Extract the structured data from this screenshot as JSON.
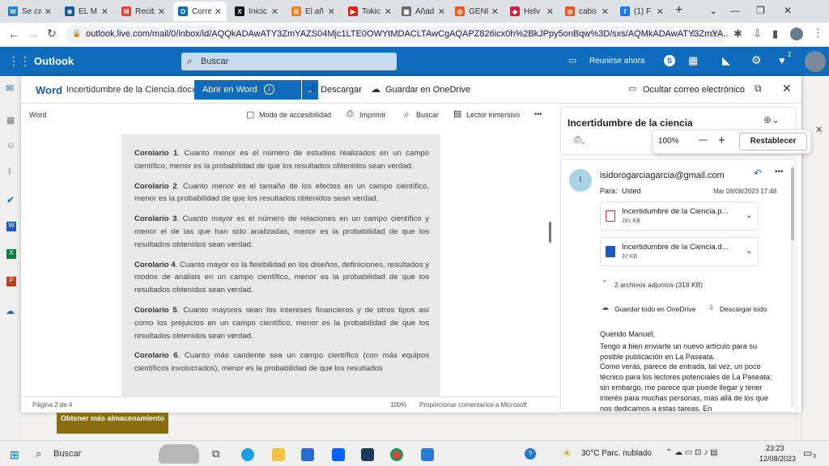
{
  "browser": {
    "tabs": [
      {
        "label": "Se ca",
        "color": "#1f7ad4",
        "glyph": "W"
      },
      {
        "label": "EL M",
        "color": "#0f5aa8",
        "glyph": "⊕"
      },
      {
        "label": "Recib",
        "color": "#ea4335",
        "glyph": "M"
      },
      {
        "label": "Corre",
        "color": "#0f6cbd",
        "glyph": "O"
      },
      {
        "label": "Inicic",
        "color": "#111111",
        "glyph": "X"
      },
      {
        "label": "El añ",
        "color": "#f4811f",
        "glyph": "B"
      },
      {
        "label": "Tokic",
        "color": "#e62117",
        "glyph": "▶"
      },
      {
        "label": "Añadi",
        "color": "#666666",
        "glyph": "▣"
      },
      {
        "label": "GENI",
        "color": "#e8561a",
        "glyph": "◎"
      },
      {
        "label": "Helv",
        "color": "#d21f3c",
        "glyph": "◆"
      },
      {
        "label": "cabo",
        "color": "#e8561a",
        "glyph": "◎"
      },
      {
        "label": "(1) F",
        "color": "#1877f2",
        "glyph": "f"
      }
    ],
    "new_tab": "+",
    "url": "outlook.live.com/mail/0/inbox/id/AQQkADAwATY3ZmYAZS04Mjc1LTE0OWYtMDACLTAwCgAQAPZ826icx0h%2BkJPpy5onBqw%3D/sxs/AQMkADAwATY3ZmYA..."
  },
  "outlook": {
    "app_name": "Outlook",
    "search_placeholder": "Buscar",
    "meeting_label": "Reunirse ahora",
    "notification_count": "2"
  },
  "viewer": {
    "app_label": "Word",
    "filename": "Incertidumbre de la Ciencia.docx",
    "open_in_word": "Abrir en Word",
    "download": "Descargar",
    "save_onedrive": "Guardar en OneDrive",
    "hide_email": "Ocultar correo electrónico",
    "word_label": "Word",
    "accessibility": "Modo de accesibilidad",
    "print": "Imprimir",
    "search": "Buscar",
    "reader": "Lector inmersivo",
    "more": "•••",
    "page_info": "Página 2 de 4",
    "zoom": "100%",
    "feedback": "Proporcionar comentarios a Microsoft"
  },
  "document": {
    "paragraphs": [
      {
        "label": "Corolario 1",
        "text": ". Cuanto menor es el número de estudios realizados en un campo científico, menor es la probabilidad de que los resultados obtenidos sean verdad."
      },
      {
        "label": "Corolario 2",
        "text": ". Cuanto menor es el tamaño de los efectos en un campo científico, menor es la probabilidad de que los resultados obtenidos sean verdad."
      },
      {
        "label": "Corolario 3",
        "text": ". Cuanto mayor es el número de relaciones en un campo científico y menor el de las que han sido analizadas, menor es la probabilidad de que los resultados obtenidos sean verdad."
      },
      {
        "label": "Corolario 4",
        "text": ". Cuanto mayor es la flexibilidad en los diseños, definiciones, resultados y modos de análisis en un campo científico, menor es la probabilidad de que los resultados obtenidos sean verdad."
      },
      {
        "label": "Corolario 5",
        "text": ". Cuanto mayores sean los intereses financieros y de otros tipos así como los prejuicios en un campo científico, menor es la probabilidad de que los resultados obtenidos sean verdad."
      },
      {
        "label": "Corolario 6",
        "text": ". Cuanto más candente sea un campo científico (con más equipos científicos involucrados), menor es la probabilidad de que los resultados"
      }
    ]
  },
  "pane": {
    "subject": "Incertidumbre de la ciencia",
    "zoom_value": "100%",
    "zoom_minus": "—",
    "zoom_plus": "+",
    "reset": "Restablecer",
    "sender_initial": "I",
    "sender": "isidorogarciagarcia@gmail.com",
    "to_label": "Para:",
    "to_value": "Usted",
    "date": "Mar 08/08/2023 17:48",
    "attachments": [
      {
        "name": "Incertidumbre de la Ciencia.p...",
        "size": "281 KB",
        "kind": "pdf",
        "color": "#d13438"
      },
      {
        "name": "Incertidumbre de la Ciencia.d...",
        "size": "37 KB",
        "kind": "docx",
        "color": "#185abd"
      }
    ],
    "attachments_count": "2 archivos adjuntos (318 KB)",
    "save_all": "Guardar todo en OneDrive",
    "download_all": "Descargar todo",
    "body": [
      "Querido Manuel,",
      "Tengo a bien enviarte un nuevo artículo para su posible publicación en La Paseata.",
      "Como verás, parece de entrada, tal vez, un poco técnico para los lectores potenciales de La Paseata; sin embargo, me parece que puede llegar y tener interés para muchas personas, más allá de los que nos dedicamos a estas tareas. En"
    ]
  },
  "background": {
    "button": "Obtener más almacenamiento"
  },
  "taskbar": {
    "search": "Buscar",
    "weather": "30°C  Parc. nublado",
    "time": "23:23",
    "date": "12/08/2023",
    "notif": "3"
  }
}
